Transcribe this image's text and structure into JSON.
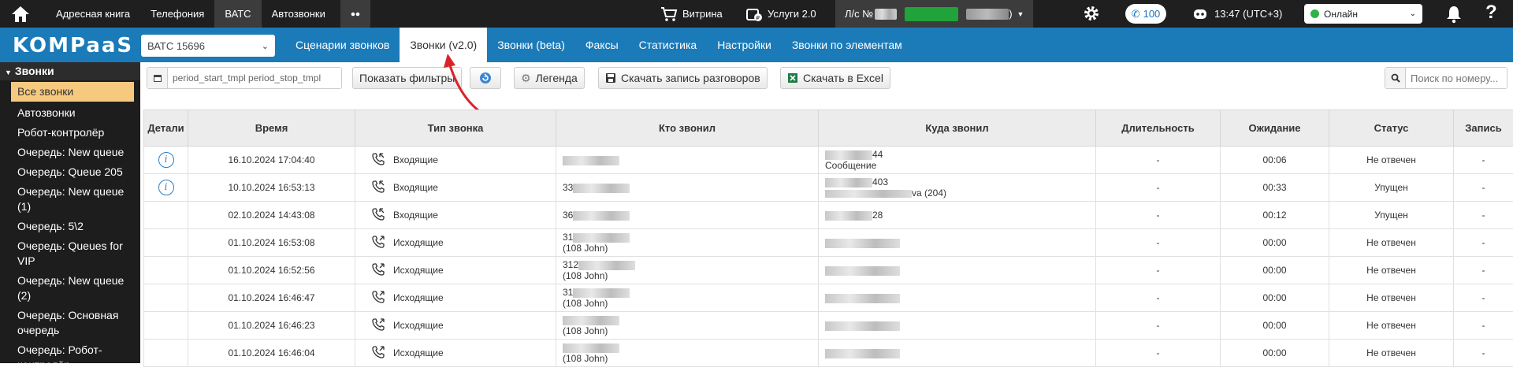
{
  "topbar": {
    "nav": [
      "Адресная книга",
      "Телефония",
      "ВАТС",
      "Автозвонки"
    ],
    "account_prefix": "Л/с №",
    "account_suffix": ")",
    "calls_count": "100",
    "time": "13:47 (UTC+3)",
    "status": "Онлайн"
  },
  "bluebar": {
    "logo": "KOMPaaS",
    "vats": "ВАТС 15696",
    "tabs": [
      "Сценарии звонков",
      "Звонки (v2.0)",
      "Звонки (beta)",
      "Факсы",
      "Статистика",
      "Настройки",
      "Звонки по элементам"
    ]
  },
  "sidebar": {
    "header": "Звонки",
    "items": [
      "Все звонки",
      "Автозвонки",
      "Робот-контролёр",
      "Очередь: New queue",
      "Очередь: Queue 205",
      "Очередь: New queue (1)",
      "Очередь: 5\\2",
      "Очередь: Queues for VIP",
      "Очередь: New queue (2)",
      "Очередь: Основная очередь",
      "Очередь: Робот-контролёр"
    ]
  },
  "toolbar": {
    "date_value": "period_start_tmpl period_stop_tmpl",
    "show_filters": "Показать фильтры",
    "legend": "Легенда",
    "download_records": "Скачать запись разговоров",
    "download_excel": "Скачать в Excel",
    "search_placeholder": "Поиск по номеру..."
  },
  "table": {
    "headers": [
      "Детали",
      "Время",
      "Тип звонка",
      "Кто звонил",
      "Куда звонил",
      "Длительность",
      "Ожидание",
      "Статус",
      "Запись"
    ],
    "rows": [
      {
        "time": "16.10.2024 17:04:40",
        "type": "Входящие",
        "from1": "",
        "from2": "",
        "to1": "44",
        "to2": "Сообщение",
        "duration": "-",
        "wait": "00:06",
        "status": "Не отвечен",
        "record": "-"
      },
      {
        "time": "10.10.2024 16:53:13",
        "type": "Входящие",
        "from1": "33",
        "from2": "",
        "to1": "403",
        "to2": "va (204)",
        "duration": "-",
        "wait": "00:33",
        "status": "Упущен",
        "record": "-"
      },
      {
        "time": "02.10.2024 14:43:08",
        "type": "Входящие",
        "from1": "36",
        "from2": "",
        "to1": "28",
        "to2": "",
        "duration": "-",
        "wait": "00:12",
        "status": "Упущен",
        "record": "-"
      },
      {
        "time": "01.10.2024 16:53:08",
        "type": "Исходящие",
        "from1": "31",
        "from2": "(108 John)",
        "to1": "",
        "to2": "",
        "duration": "-",
        "wait": "00:00",
        "status": "Не отвечен",
        "record": "-"
      },
      {
        "time": "01.10.2024 16:52:56",
        "type": "Исходящие",
        "from1": "312",
        "from2": "(108 John)",
        "to1": "",
        "to2": "",
        "duration": "-",
        "wait": "00:00",
        "status": "Не отвечен",
        "record": "-"
      },
      {
        "time": "01.10.2024 16:46:47",
        "type": "Исходящие",
        "from1": "31",
        "from2": "(108 John)",
        "to1": "",
        "to2": "",
        "duration": "-",
        "wait": "00:00",
        "status": "Не отвечен",
        "record": "-"
      },
      {
        "time": "01.10.2024 16:46:23",
        "type": "Исходящие",
        "from1": "",
        "from2": "(108 John)",
        "to1": "",
        "to2": "",
        "duration": "-",
        "wait": "00:00",
        "status": "Не отвечен",
        "record": "-"
      },
      {
        "time": "01.10.2024 16:46:04",
        "type": "Исходящие",
        "from1": "",
        "from2": "(108 John)",
        "to1": "",
        "to2": "",
        "duration": "-",
        "wait": "00:00",
        "status": "Не отвечен",
        "record": "-"
      }
    ]
  },
  "colors": {
    "topbar": "#1f1f1f",
    "bluebar": "#1b7ab8",
    "sidebar_active": "#f6c97f",
    "info": "#2a7fc8",
    "annotation_arrow": "#d9232a"
  }
}
